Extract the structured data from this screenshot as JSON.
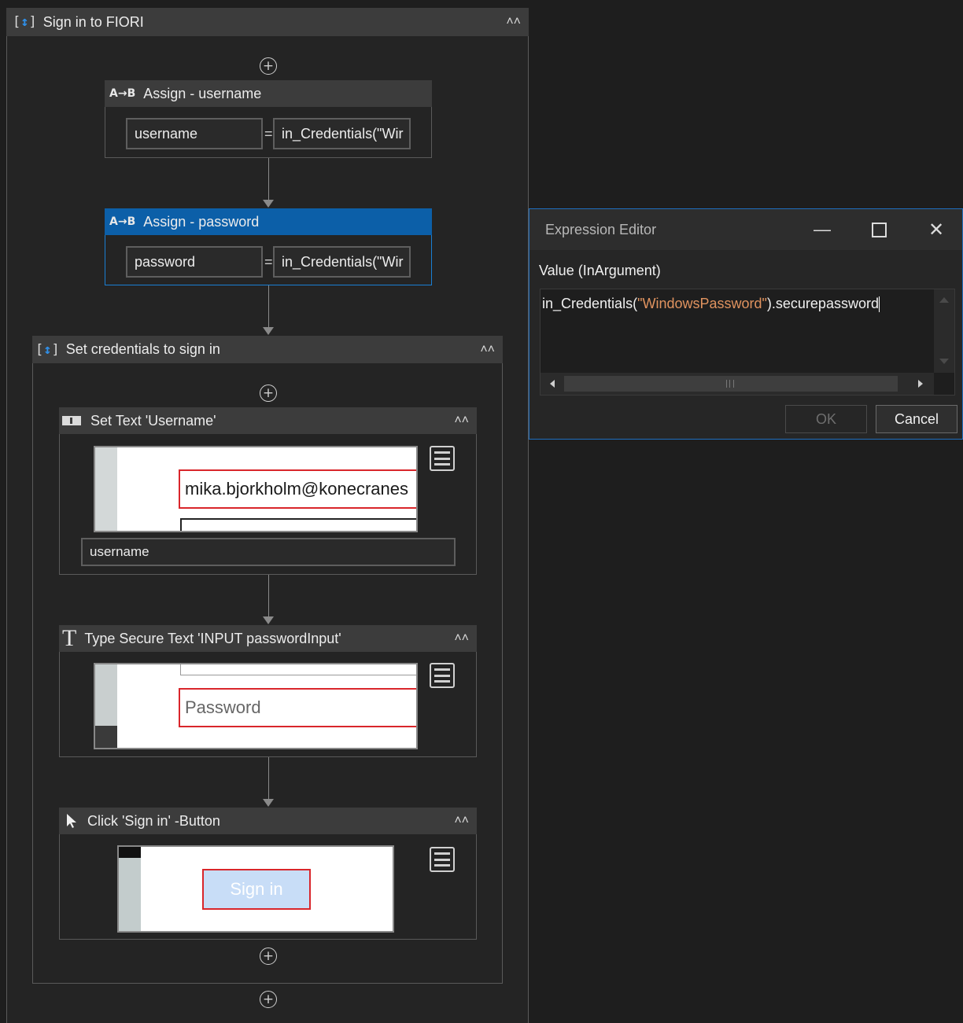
{
  "workflow": {
    "outer_title": "Sign in to FIORI",
    "assign_username": {
      "title": "Assign - username",
      "to": "username",
      "value": "in_Credentials(\"Wir"
    },
    "assign_password": {
      "title": "Assign - password",
      "to": "password",
      "value": "in_Credentials(\"Wir"
    },
    "inner_sequence": {
      "title": "Set credentials to sign in"
    },
    "set_text": {
      "title": "Set Text 'Username'",
      "preview_text": "mika.bjorkholm@konecranes",
      "text_field": "username"
    },
    "type_secure": {
      "title": "Type Secure Text 'INPUT  passwordInput'",
      "preview_placeholder": "Password"
    },
    "click_signin": {
      "title": "Click 'Sign in' -Button",
      "preview_button": "Sign in"
    }
  },
  "dialog": {
    "title": "Expression Editor",
    "label": "Value (InArgument)",
    "expr_prefix": "in_Credentials(",
    "expr_string": "\"WindowsPassword\"",
    "expr_suffix": ").securepassword",
    "ok_label": "OK",
    "cancel_label": "Cancel"
  },
  "colors": {
    "selected_header": "#0c5fa8",
    "string_literal": "#e0935f",
    "highlight_box": "#d9262b"
  }
}
